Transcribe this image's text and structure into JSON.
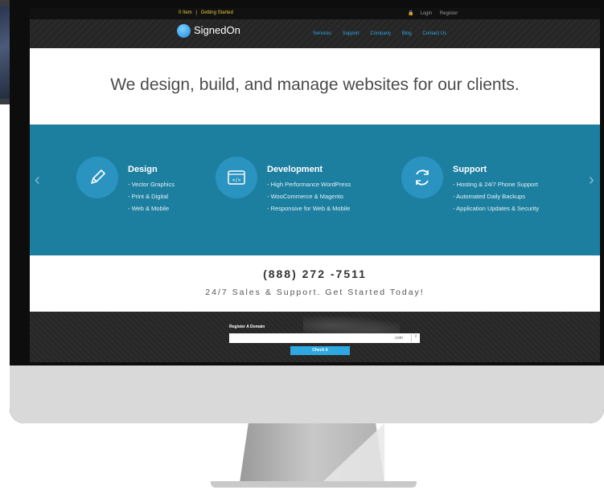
{
  "topbar": {
    "cart": "0 Item",
    "separator": "|",
    "getting_started": "Getting Started",
    "login": "Login",
    "register": "Register"
  },
  "header": {
    "logo_text": "SignedOn",
    "nav": [
      "Services",
      "Support",
      "Company",
      "Blog",
      "Contact Us"
    ]
  },
  "hero": {
    "headline": "We design, build, and manage websites for our clients."
  },
  "features": [
    {
      "icon": "pencil-icon",
      "title": "Design",
      "items": [
        "Vector Graphics",
        "Print & Digital",
        "Web & Mobile"
      ]
    },
    {
      "icon": "code-window-icon",
      "title": "Development",
      "items": [
        "High Performance WordPress",
        "WooCommerce & Magento",
        "Responsive for Web & Mobile"
      ]
    },
    {
      "icon": "refresh-icon",
      "title": "Support",
      "items": [
        "Hosting & 24/7 Phone Support",
        "Automated Daily Backups",
        "Application Updates & Security"
      ]
    }
  ],
  "carousel": {
    "prev": "‹",
    "next": "›"
  },
  "contact": {
    "phone": "(888) 272 -7511",
    "tagline": "24/7 Sales & Support. Get Started Today!"
  },
  "domain": {
    "label": "Register A Domain",
    "extension": ".com",
    "dropdown": "v",
    "button": "Check it"
  },
  "colors": {
    "band": "#1d7fa0",
    "accent": "#2ea8e0",
    "topbar_text": "#e8c93a"
  }
}
